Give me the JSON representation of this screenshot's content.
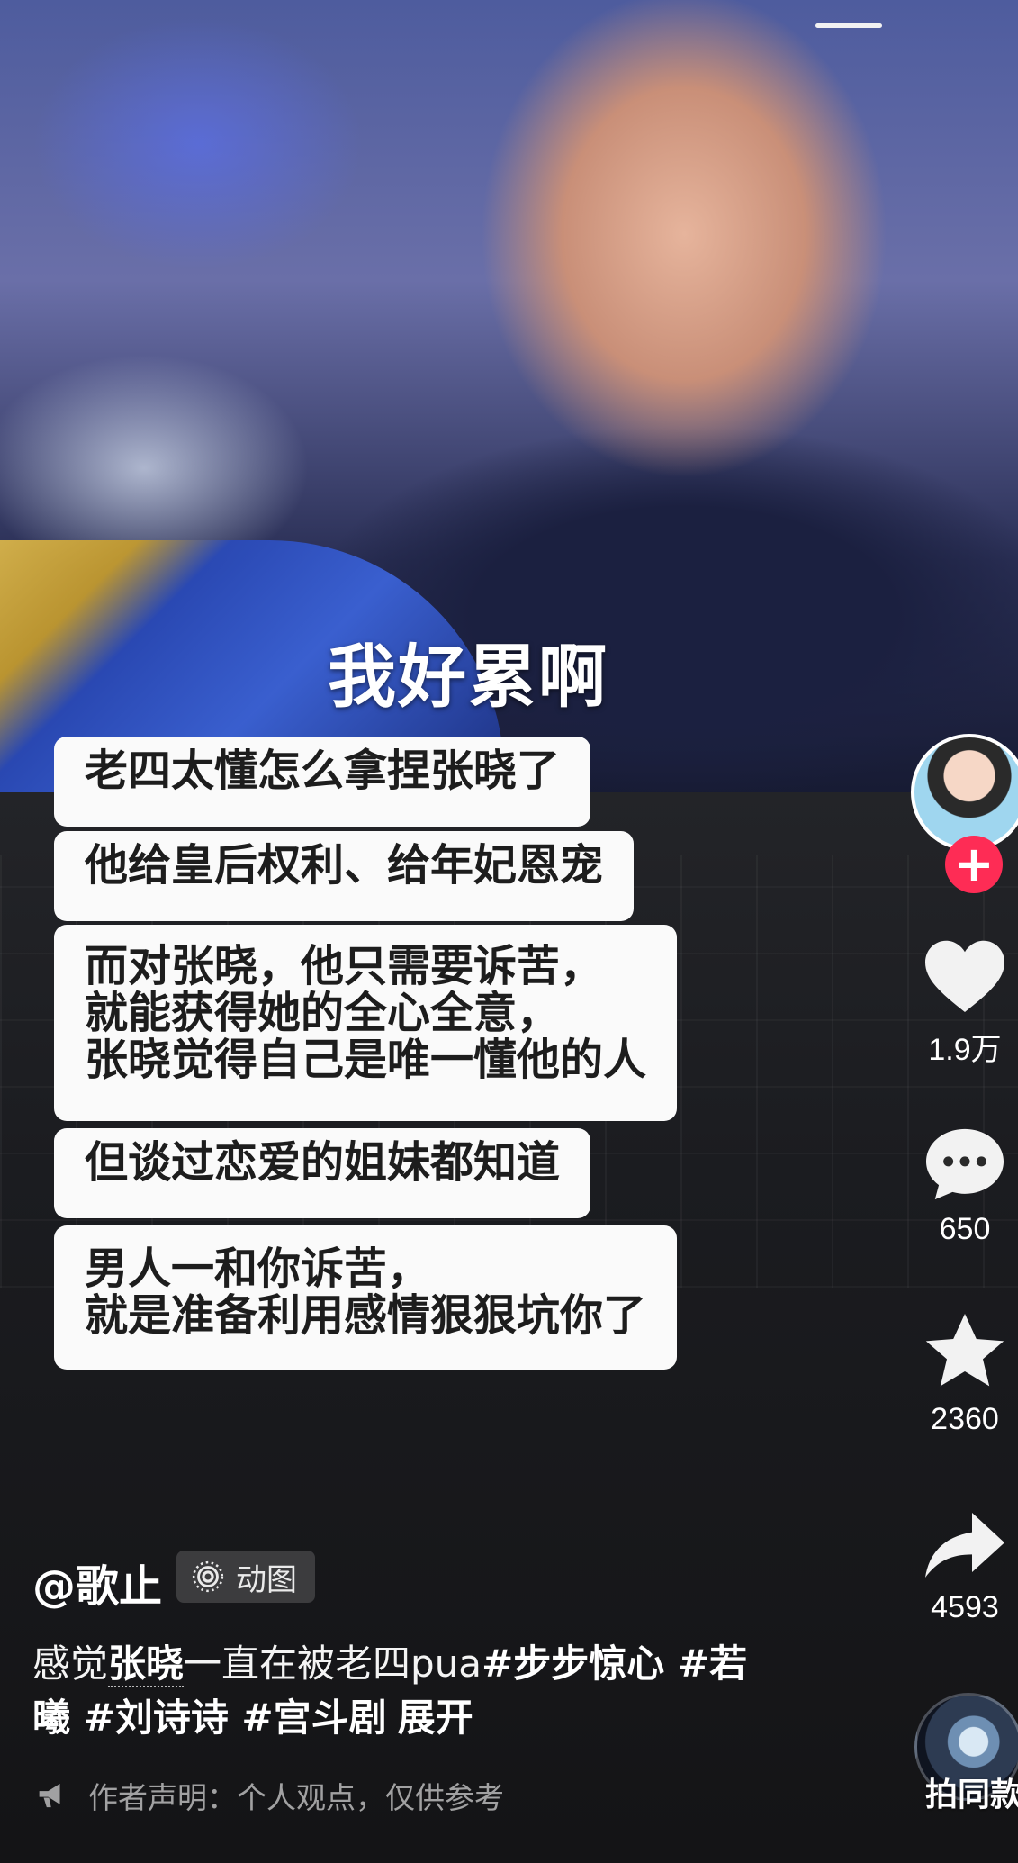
{
  "video": {
    "overlay_title": "我好累啊",
    "bubbles": [
      {
        "lines": [
          "老四太懂怎么拿捏张晓了"
        ]
      },
      {
        "lines": [
          "他给皇后权利、给年妃恩宠"
        ]
      },
      {
        "lines": [
          "而对张晓，他只需要诉苦，",
          "就能获得她的全心全意，",
          "张晓觉得自己是唯一懂他的人"
        ]
      },
      {
        "lines": [
          "但谈过恋爱的姐妹都知道"
        ]
      },
      {
        "lines": [
          "男人一和你诉苦，",
          "就是准备利用感情狠狠坑你了"
        ]
      }
    ]
  },
  "side_bar": {
    "follow_icon": "plus",
    "like_count": "1.9万",
    "comment_count": "650",
    "favorite_count": "2360",
    "share_count": "4593",
    "music_label": "拍同款"
  },
  "info": {
    "author": "@歌止",
    "tag_pill": "动图",
    "caption": {
      "prefix": "感觉",
      "highlight": "张晓",
      "middle": "一直在被老四pua",
      "tags_line1": "#步步惊心 #若",
      "tags_line2": "曦 #刘诗诗 #宫斗剧",
      "expand": "展开"
    },
    "notice": "作者声明：个人观点，仅供参考"
  },
  "colors": {
    "follow": "#fe2c55",
    "bubble_bg": "#fafafa",
    "bubble_text": "#1d1d1d",
    "background": "#141416"
  }
}
